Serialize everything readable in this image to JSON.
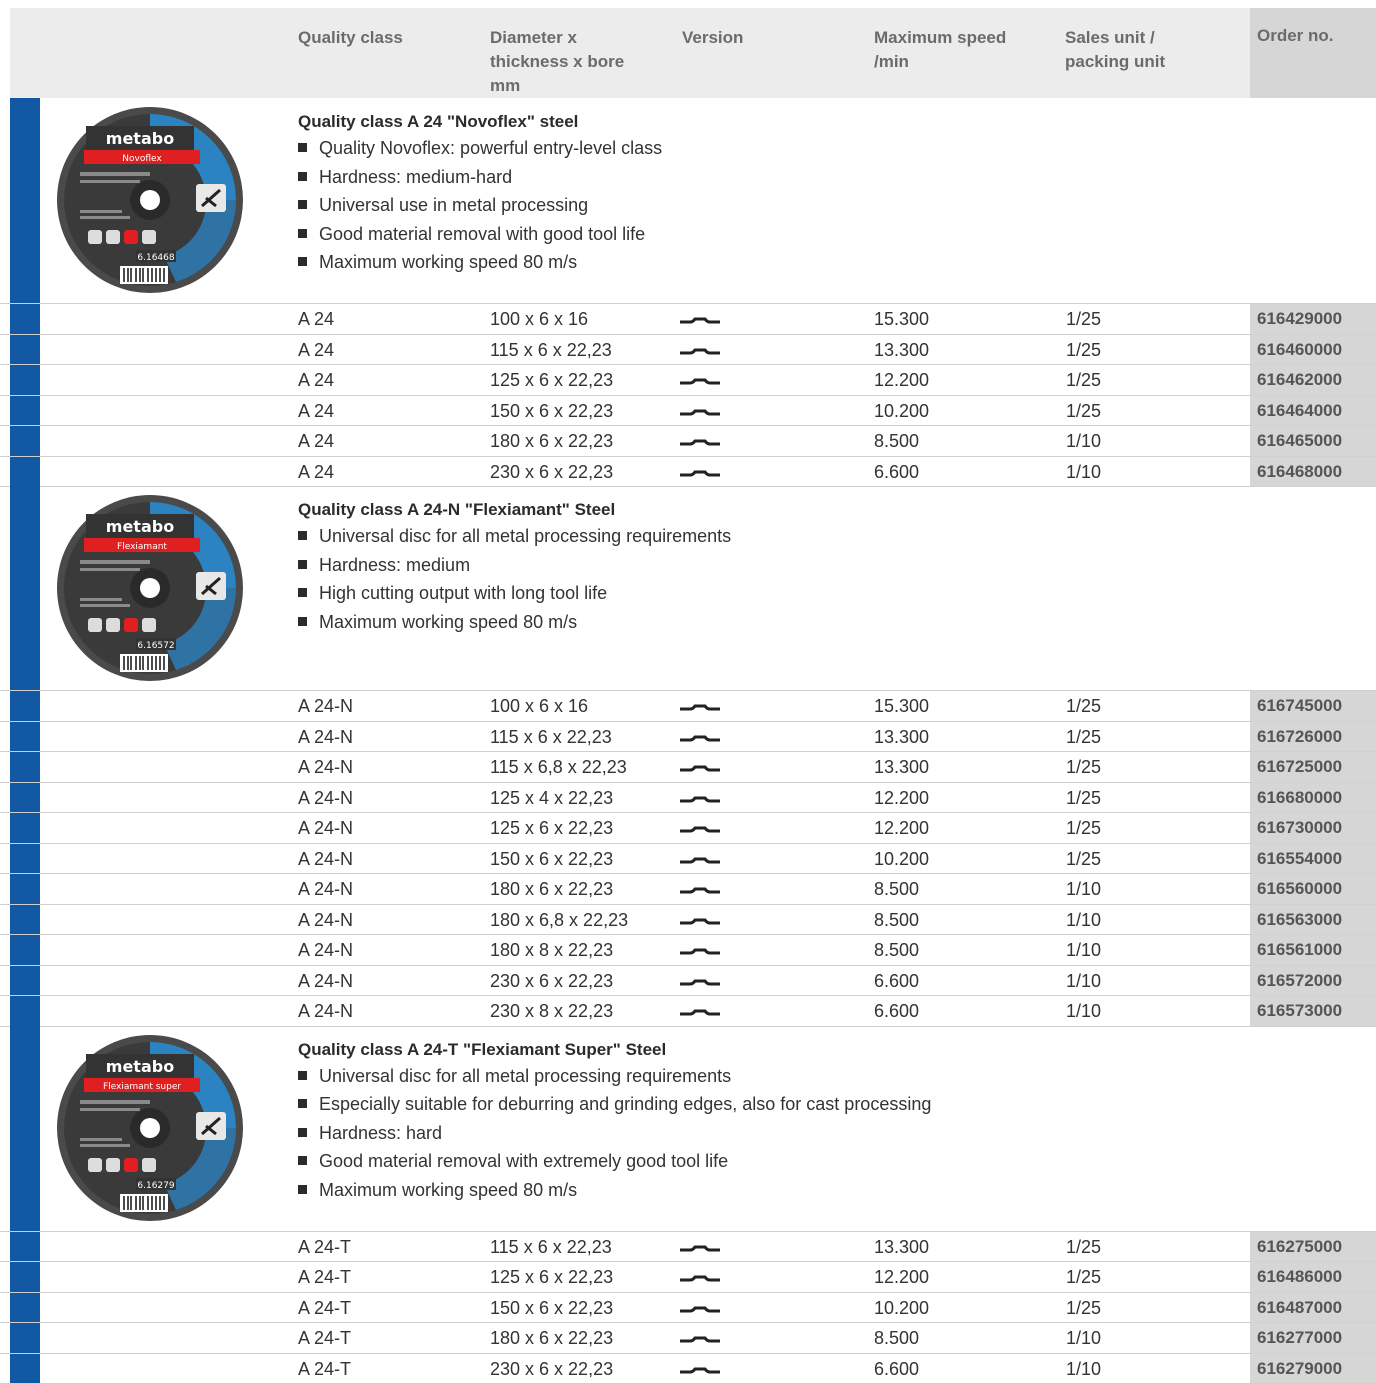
{
  "header": {
    "quality_class": "Quality class",
    "diameter": "Diameter x\nthickness x bore\nmm",
    "version": "Version",
    "max_speed": "Maximum speed\n/min",
    "sales_unit": "Sales unit /\npacking unit",
    "order_no": "Order no."
  },
  "sections": [
    {
      "disc_brand": "metabo",
      "disc_name": "Novoflex",
      "disc_number": "6.16468",
      "title": "Quality class A 24 \"Novoflex\" steel",
      "bullets": [
        "Quality Novoflex: powerful entry-level class",
        "Hardness: medium-hard",
        "Universal use in metal processing",
        "Good material removal with good tool life",
        "Maximum working speed 80 m/s"
      ],
      "rows": [
        {
          "quality": "A 24",
          "dim": "100 x 6 x 16",
          "speed": "15.300",
          "unit": "1/25",
          "order": "616429000"
        },
        {
          "quality": "A 24",
          "dim": "115 x 6 x 22,23",
          "speed": "13.300",
          "unit": "1/25",
          "order": "616460000"
        },
        {
          "quality": "A 24",
          "dim": "125 x 6 x 22,23",
          "speed": "12.200",
          "unit": "1/25",
          "order": "616462000"
        },
        {
          "quality": "A 24",
          "dim": "150 x 6 x 22,23",
          "speed": "10.200",
          "unit": "1/25",
          "order": "616464000"
        },
        {
          "quality": "A 24",
          "dim": "180 x 6 x 22,23",
          "speed": "8.500",
          "unit": "1/10",
          "order": "616465000"
        },
        {
          "quality": "A 24",
          "dim": "230 x 6 x 22,23",
          "speed": "6.600",
          "unit": "1/10",
          "order": "616468000"
        }
      ]
    },
    {
      "disc_brand": "metabo",
      "disc_name": "Flexiamant",
      "disc_number": "6.16572",
      "title": "Quality class A 24-N \"Flexiamant\" Steel",
      "bullets": [
        "Universal disc for all metal processing requirements",
        "Hardness: medium",
        "High cutting output with long tool life",
        "Maximum working speed 80 m/s"
      ],
      "rows": [
        {
          "quality": "A 24-N",
          "dim": "100 x 6 x 16",
          "speed": "15.300",
          "unit": "1/25",
          "order": "616745000"
        },
        {
          "quality": "A 24-N",
          "dim": "115 x 6 x 22,23",
          "speed": "13.300",
          "unit": "1/25",
          "order": "616726000"
        },
        {
          "quality": "A 24-N",
          "dim": "115 x 6,8 x 22,23",
          "speed": "13.300",
          "unit": "1/25",
          "order": "616725000"
        },
        {
          "quality": "A 24-N",
          "dim": "125 x 4 x 22,23",
          "speed": "12.200",
          "unit": "1/25",
          "order": "616680000"
        },
        {
          "quality": "A 24-N",
          "dim": "125 x 6 x 22,23",
          "speed": "12.200",
          "unit": "1/25",
          "order": "616730000"
        },
        {
          "quality": "A 24-N",
          "dim": "150 x 6 x 22,23",
          "speed": "10.200",
          "unit": "1/25",
          "order": "616554000"
        },
        {
          "quality": "A 24-N",
          "dim": "180 x 6 x 22,23",
          "speed": "8.500",
          "unit": "1/10",
          "order": "616560000"
        },
        {
          "quality": "A 24-N",
          "dim": "180 x 6,8 x 22,23",
          "speed": "8.500",
          "unit": "1/10",
          "order": "616563000"
        },
        {
          "quality": "A 24-N",
          "dim": "180 x 8 x 22,23",
          "speed": "8.500",
          "unit": "1/10",
          "order": "616561000"
        },
        {
          "quality": "A 24-N",
          "dim": "230 x 6 x 22,23",
          "speed": "6.600",
          "unit": "1/10",
          "order": "616572000"
        },
        {
          "quality": "A 24-N",
          "dim": "230 x 8 x 22,23",
          "speed": "6.600",
          "unit": "1/10",
          "order": "616573000"
        }
      ]
    },
    {
      "disc_brand": "metabo",
      "disc_name": "Flexiamant super",
      "disc_number": "6.16279",
      "title": "Quality class A 24-T \"Flexiamant Super\" Steel",
      "bullets": [
        "Universal disc for all metal processing requirements",
        "Especially suitable for deburring and grinding edges, also for cast processing",
        "Hardness: hard",
        "Good material removal with extremely good tool life",
        "Maximum working speed 80 m/s"
      ],
      "rows": [
        {
          "quality": "A 24-T",
          "dim": "115 x 6 x 22,23",
          "speed": "13.300",
          "unit": "1/25",
          "order": "616275000"
        },
        {
          "quality": "A 24-T",
          "dim": "125 x 6 x 22,23",
          "speed": "12.200",
          "unit": "1/25",
          "order": "616486000"
        },
        {
          "quality": "A 24-T",
          "dim": "150 x 6 x 22,23",
          "speed": "10.200",
          "unit": "1/25",
          "order": "616487000"
        },
        {
          "quality": "A 24-T",
          "dim": "180 x 6 x 22,23",
          "speed": "8.500",
          "unit": "1/10",
          "order": "616277000"
        },
        {
          "quality": "A 24-T",
          "dim": "230 x 6 x 22,23",
          "speed": "6.600",
          "unit": "1/10",
          "order": "616279000"
        }
      ]
    }
  ],
  "colors": {
    "brand_blue": "#1159a3",
    "header_grey": "#ececec",
    "order_grey": "#d6d6d6",
    "disc_red": "#e02020",
    "disc_blue": "#2b87c8"
  },
  "icons": {
    "version": "depressed-centre-profile-icon",
    "bullet": "square-bullet-icon"
  }
}
